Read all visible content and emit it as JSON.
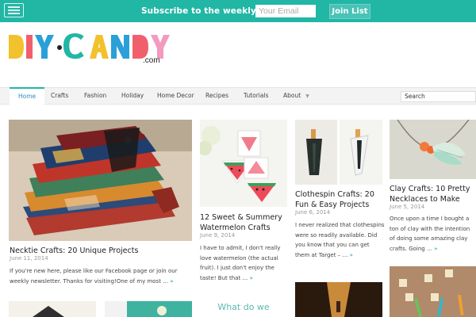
{
  "topbar": {
    "subscribe_text": "Subscribe to the weekly email!",
    "email_placeholder": "Your Email",
    "join_label": "Join List",
    "accent_color": "#22b6a5"
  },
  "logo": {
    "text": "DIY·CANDY",
    "sub": ".com"
  },
  "nav": {
    "items": [
      "Home",
      "Crafts",
      "Fashion",
      "Holiday",
      "Home Decor",
      "Recipes",
      "Tutorials",
      "About"
    ],
    "active": "Home",
    "search_placeholder": "Search"
  },
  "posts": [
    {
      "title": "Necktie Crafts: 20 Unique Projects",
      "date": "June 11, 2014",
      "excerpt": "If you're new here, please like our Facebook page or join our weekly newsletter. Thanks for visiting!One of my most …",
      "more": "»"
    },
    {
      "title": "12 Sweet & Summery Watermelon Crafts",
      "date": "June 9, 2014",
      "excerpt": "I have to admit, I don't really love watermelon (the actual fruit). I just don't enjoy the taste! But that …",
      "more": "»"
    },
    {
      "title": "Clothespin Crafts: 20 Fun & Easy Projects",
      "date": "June 6, 2014",
      "excerpt": "I never realized that clothespins were so readily available. Did you know that you can get them at Target – …",
      "more": "»"
    },
    {
      "title": "Clay Crafts: 10 Pretty Necklaces to Make",
      "date": "June 5, 2014",
      "excerpt": "Once upon a time I bought a ton of clay with the intention of doing some amazing clay crafts. Going …",
      "more": "»"
    }
  ],
  "bottom_thumbs": {
    "partial_text": "What do we"
  }
}
